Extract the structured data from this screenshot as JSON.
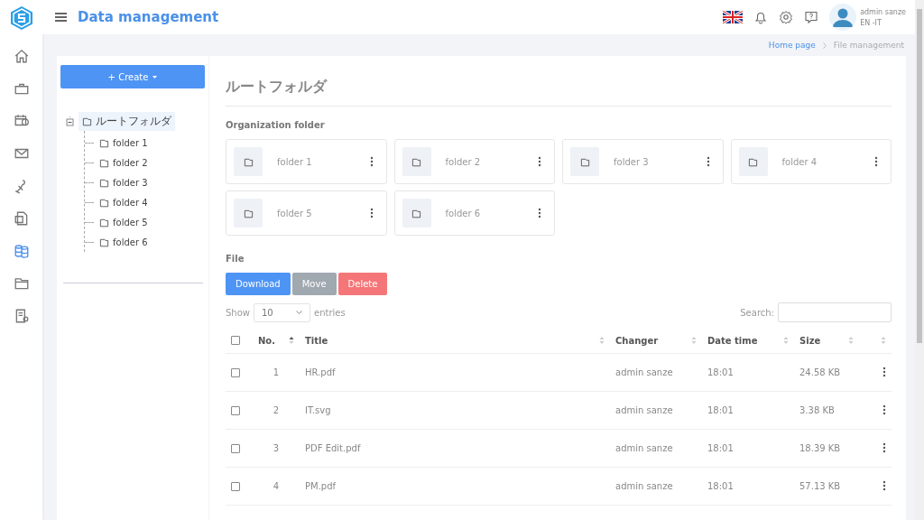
{
  "header": {
    "title": "Data management",
    "user_name": "admin sanze",
    "user_lang": "EN -IT"
  },
  "sidebar": {
    "items": [
      {
        "selected": false
      },
      {
        "selected": false
      },
      {
        "selected": false
      },
      {
        "selected": false
      },
      {
        "selected": false
      },
      {
        "selected": false
      },
      {
        "selected": true
      },
      {
        "selected": false
      },
      {
        "selected": false
      }
    ]
  },
  "breadcrumb": [
    "Home page",
    "File management"
  ],
  "create_button": "+ Create",
  "tree": {
    "label": "ルートフォルダ",
    "selected": true,
    "expanded": true,
    "children": [
      {
        "label": "folder 1",
        "selected": false
      },
      {
        "label": "folder 2",
        "selected": false
      },
      {
        "label": "folder 3",
        "selected": false
      },
      {
        "label": "folder 4",
        "selected": false
      },
      {
        "label": "folder 5",
        "selected": false
      },
      {
        "label": "folder 6",
        "selected": false
      }
    ]
  },
  "page_title": "ルートフォルダ",
  "folders_heading": "Organization folder",
  "folders": [
    "folder 1",
    "folder 2",
    "folder 3",
    "folder 4",
    "folder 5",
    "folder 6"
  ],
  "files_heading": "File",
  "actions": [
    {
      "label": "Download",
      "kind": "primary"
    },
    {
      "label": "Move",
      "kind": "secondary"
    },
    {
      "label": "Delete",
      "kind": "danger"
    }
  ],
  "length": {
    "prefix": "Show",
    "value": "10",
    "suffix": "entries"
  },
  "search_label": "Search:",
  "table": {
    "all_checked": false,
    "columns": [
      {
        "label": "No.",
        "sorted": true
      },
      {
        "label": "Title",
        "sorted": false
      },
      {
        "label": "Changer",
        "sorted": false
      },
      {
        "label": "Date time",
        "sorted": false
      },
      {
        "label": "Size",
        "sorted": false
      }
    ],
    "rows": [
      {
        "checked": false,
        "no": "1",
        "title": "HR.pdf",
        "changer": "admin sanze",
        "time": "18:01",
        "size": "24.58 KB"
      },
      {
        "checked": false,
        "no": "2",
        "title": "IT.svg",
        "changer": "admin sanze",
        "time": "18:01",
        "size": "3.38 KB"
      },
      {
        "checked": false,
        "no": "3",
        "title": "PDF Edit.pdf",
        "changer": "admin sanze",
        "time": "18:01",
        "size": "18.39 KB"
      },
      {
        "checked": false,
        "no": "4",
        "title": "PM.pdf",
        "changer": "admin sanze",
        "time": "18:01",
        "size": "57.13 KB"
      }
    ]
  }
}
